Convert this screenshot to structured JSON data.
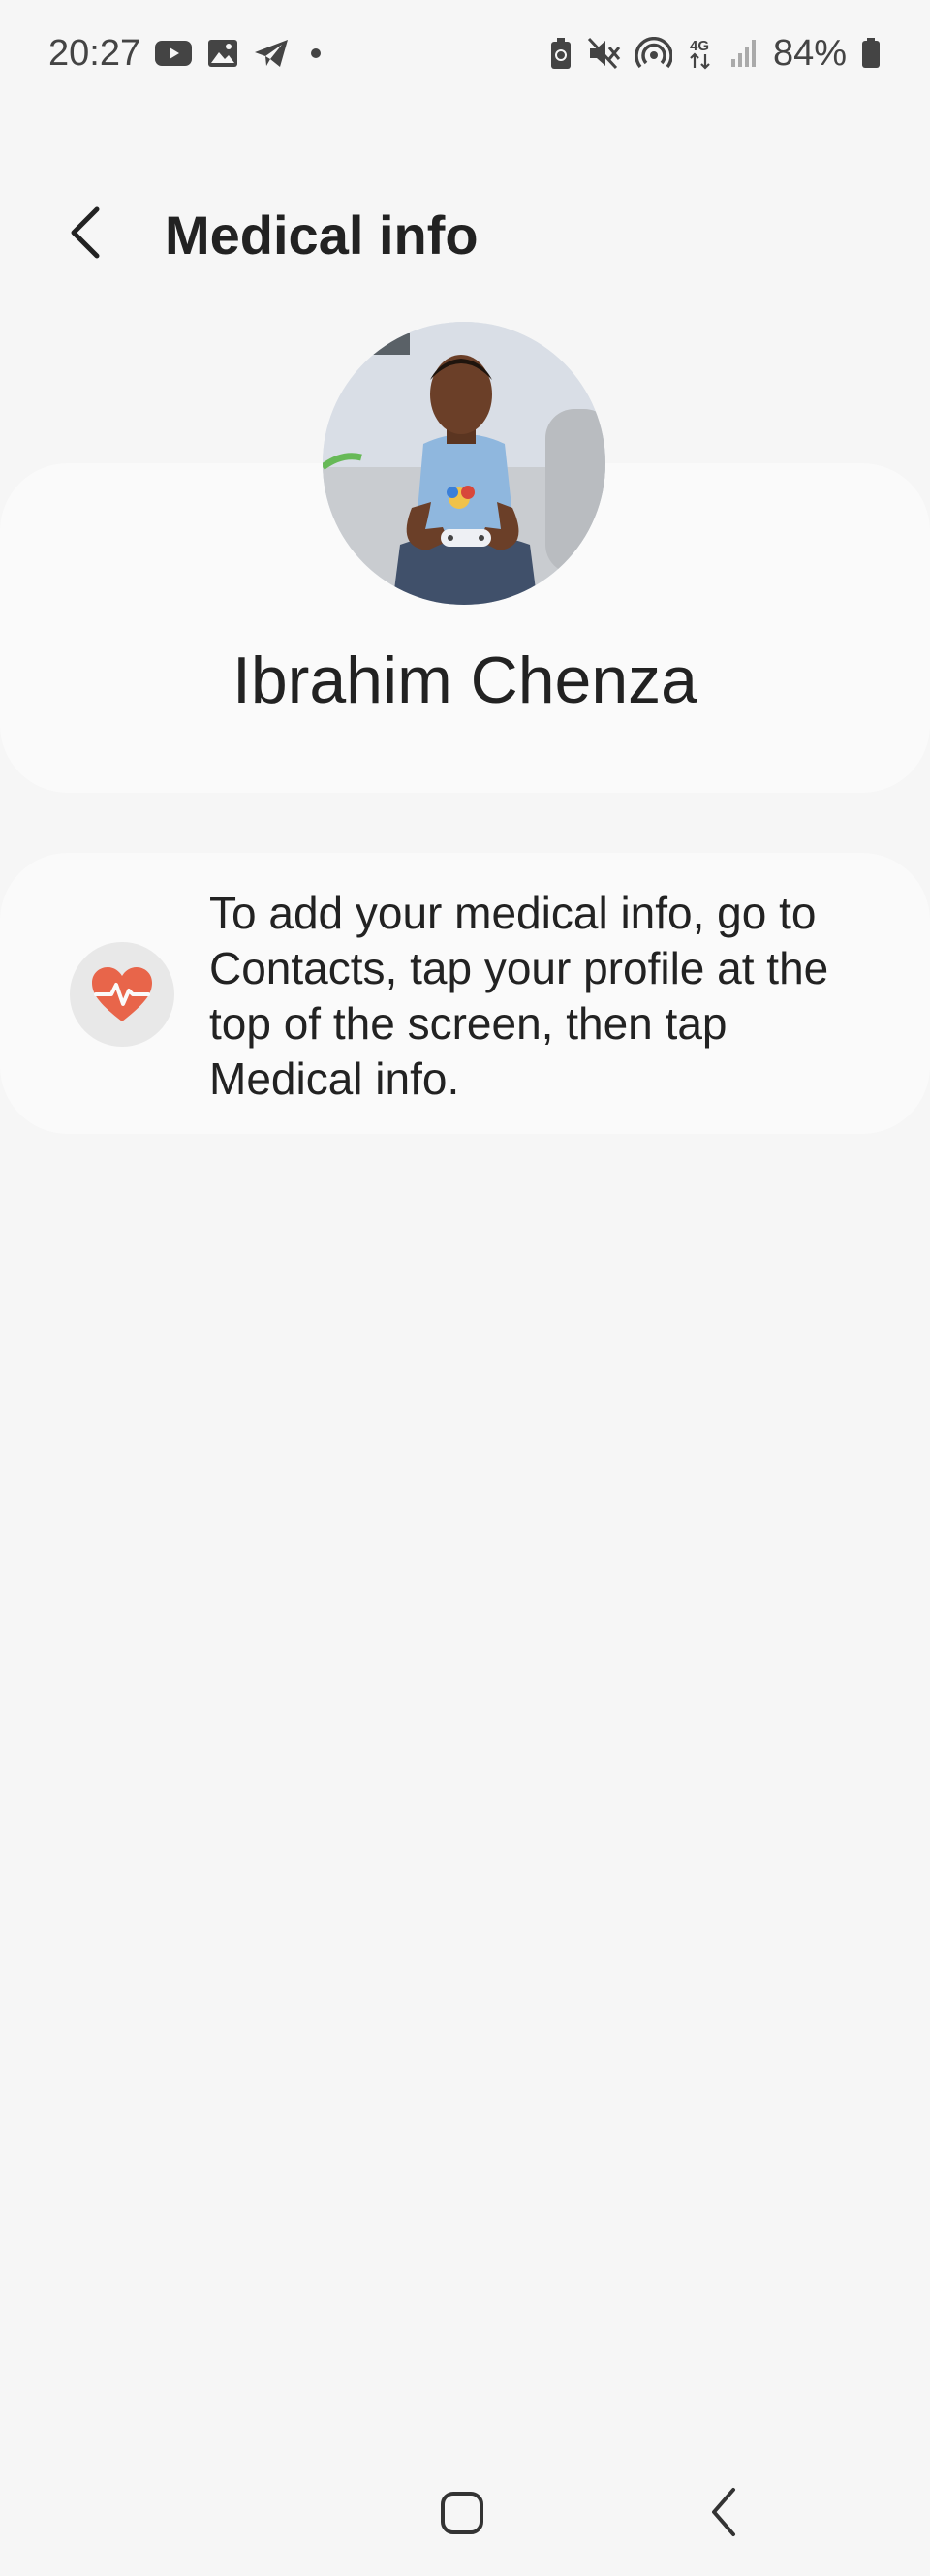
{
  "status_bar": {
    "time": "20:27",
    "notification_icons": [
      "youtube-icon",
      "gallery-icon",
      "telegram-icon",
      "dot-icon"
    ],
    "system_icons": [
      "battery-saver-icon",
      "mute-icon",
      "hotspot-icon",
      "4g-icon",
      "signal-icon"
    ],
    "network_label": "4G",
    "battery_percent": "84%"
  },
  "header": {
    "title": "Medical info"
  },
  "profile": {
    "name": "Ibrahim Chenza"
  },
  "medical_card": {
    "icon": "heart-pulse-icon",
    "message": "To add your medical info, go to Contacts, tap your profile at the top of the screen, then tap Medical info."
  },
  "colors": {
    "background": "#f6f6f6",
    "card": "#fafafa",
    "heart_accent": "#e8654a"
  }
}
